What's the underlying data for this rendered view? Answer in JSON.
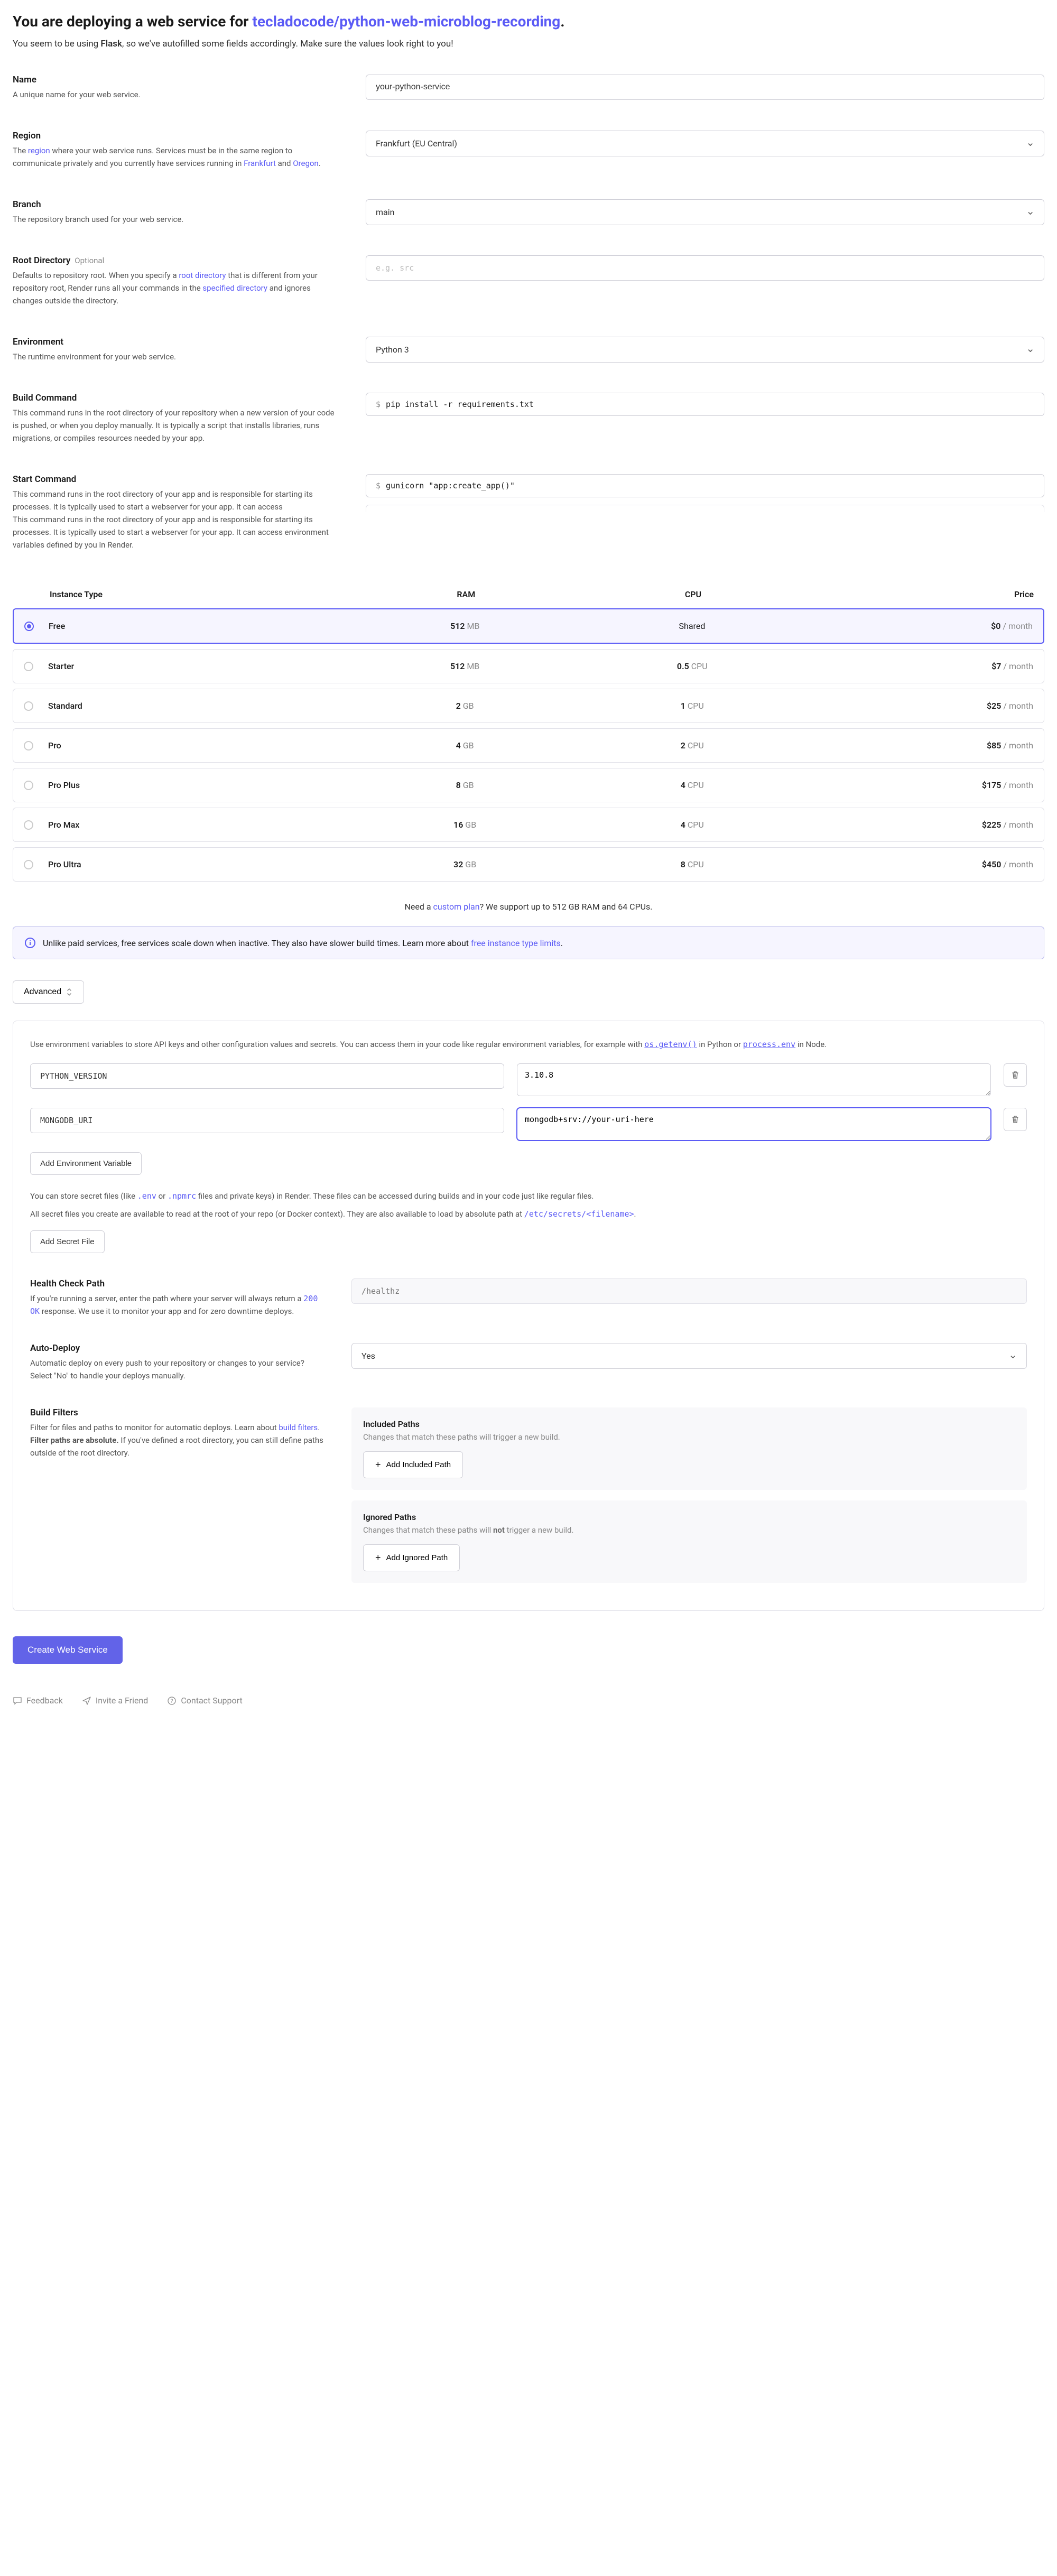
{
  "header": {
    "title_prefix": "You are deploying a web service for ",
    "repo": "tecladocode/python-web-microblog-recording",
    "subtitle_pre": "You seem to be using ",
    "framework": "Flask",
    "subtitle_post": ", so we've autofilled some fields accordingly. Make sure the values look right to you!"
  },
  "fields": {
    "name": {
      "label": "Name",
      "desc": "A unique name for your web service.",
      "value": "your-python-service"
    },
    "region": {
      "label": "Region",
      "desc_parts": [
        "The ",
        "region",
        " where your web service runs. Services must be in the same region to communicate privately and you currently have services running in ",
        "Frankfurt",
        " and ",
        "Oregon",
        "."
      ],
      "value": "Frankfurt (EU Central)"
    },
    "branch": {
      "label": "Branch",
      "desc": "The repository branch used for your web service.",
      "value": "main"
    },
    "root": {
      "label": "Root Directory",
      "optional": "Optional",
      "desc_parts": [
        "Defaults to repository root. When you specify a ",
        "root directory",
        " that is different from your repository root, Render runs all your commands in the ",
        "specified directory",
        " and ignores changes outside the directory."
      ],
      "placeholder": "e.g. src"
    },
    "env": {
      "label": "Environment",
      "desc": "The runtime environment for your web service.",
      "value": "Python 3"
    },
    "build": {
      "label": "Build Command",
      "desc": "This command runs in the root directory of your repository when a new version of your code is pushed, or when you deploy manually. It is typically a script that installs libraries, runs migrations, or compiles resources needed by your app.",
      "value": "pip install -r requirements.txt"
    },
    "start": {
      "label": "Start Command",
      "desc": "This command runs in the root directory of your app and is responsible for starting its processes. It is typically used to start a webserver for your app. It can access",
      "desc2": "This command runs in the root directory of your app and is responsible for starting its processes. It is typically used to start a webserver for your app. It can access environment variables defined by you in Render.",
      "value": "gunicorn \"app:create_app()\""
    }
  },
  "instance": {
    "headers": {
      "type": "Instance Type",
      "ram": "RAM",
      "cpu": "CPU",
      "price": "Price"
    },
    "rows": [
      {
        "name": "Free",
        "ram_val": "512",
        "ram_unit": "MB",
        "cpu_val": "Shared",
        "cpu_unit": "",
        "price": "$0",
        "selected": true
      },
      {
        "name": "Starter",
        "ram_val": "512",
        "ram_unit": "MB",
        "cpu_val": "0.5",
        "cpu_unit": "CPU",
        "price": "$7",
        "selected": false
      },
      {
        "name": "Standard",
        "ram_val": "2",
        "ram_unit": "GB",
        "cpu_val": "1",
        "cpu_unit": "CPU",
        "price": "$25",
        "selected": false
      },
      {
        "name": "Pro",
        "ram_val": "4",
        "ram_unit": "GB",
        "cpu_val": "2",
        "cpu_unit": "CPU",
        "price": "$85",
        "selected": false
      },
      {
        "name": "Pro Plus",
        "ram_val": "8",
        "ram_unit": "GB",
        "cpu_val": "4",
        "cpu_unit": "CPU",
        "price": "$175",
        "selected": false
      },
      {
        "name": "Pro Max",
        "ram_val": "16",
        "ram_unit": "GB",
        "cpu_val": "4",
        "cpu_unit": "CPU",
        "price": "$225",
        "selected": false
      },
      {
        "name": "Pro Ultra",
        "ram_val": "32",
        "ram_unit": "GB",
        "cpu_val": "8",
        "cpu_unit": "CPU",
        "price": "$450",
        "selected": false
      }
    ],
    "per_month": "/ month",
    "custom_pre": "Need a ",
    "custom_link": "custom plan",
    "custom_post": "? We support up to 512 GB RAM and 64 CPUs.",
    "banner_text": "Unlike paid services, free services scale down when inactive. They also have slower build times. Learn more about ",
    "banner_link": "free instance type limits"
  },
  "advanced": {
    "button": "Advanced",
    "env_intro_parts": [
      "Use environment variables to store API keys and other configuration values and secrets. You can access them in your code like regular environment variables, for example with ",
      "os.getenv()",
      " in Python or ",
      "process.env",
      " in Node."
    ],
    "env_vars": [
      {
        "key": "PYTHON_VERSION",
        "value": "3.10.8",
        "focused": false
      },
      {
        "key": "MONGODB_URI",
        "value": "mongodb+srv://your-uri-here",
        "focused": true
      }
    ],
    "add_env_btn": "Add Environment Variable",
    "secret_p1_parts": [
      "You can store secret files (like ",
      ".env",
      " or ",
      ".npmrc",
      " files and private keys) in Render. These files can be accessed during builds and in your code just like regular files."
    ],
    "secret_p2_parts": [
      "All secret files you create are available to read at the root of your repo (or Docker context). They are also available to load by absolute path at ",
      "/etc/secrets/<filename>",
      "."
    ],
    "add_secret_btn": "Add Secret File",
    "health": {
      "label": "Health Check Path",
      "desc_parts": [
        "If you're running a server, enter the path where your server will always return a ",
        "200 OK",
        " response. We use it to monitor your app and for zero downtime deploys."
      ],
      "placeholder": "/healthz"
    },
    "autodeploy": {
      "label": "Auto-Deploy",
      "desc": "Automatic deploy on every push to your repository or changes to your service? Select \"No\" to handle your deploys manually.",
      "value": "Yes"
    },
    "filters": {
      "label": "Build Filters",
      "desc_parts": [
        "Filter for files and paths to monitor for automatic deploys. Learn about ",
        "build filters",
        ". ",
        "Filter paths are absolute.",
        " If you've defined a root directory, you can still define paths outside of the root directory."
      ],
      "included_title": "Included Paths",
      "included_desc": "Changes that match these paths will trigger a new build.",
      "included_btn": "Add Included Path",
      "ignored_title": "Ignored Paths",
      "ignored_desc_pre": "Changes that match these paths will ",
      "ignored_not": "not",
      "ignored_desc_post": " trigger a new build.",
      "ignored_btn": "Add Ignored Path"
    }
  },
  "create_btn": "Create Web Service",
  "footer": {
    "feedback": "Feedback",
    "invite": "Invite a Friend",
    "support": "Contact Support"
  }
}
